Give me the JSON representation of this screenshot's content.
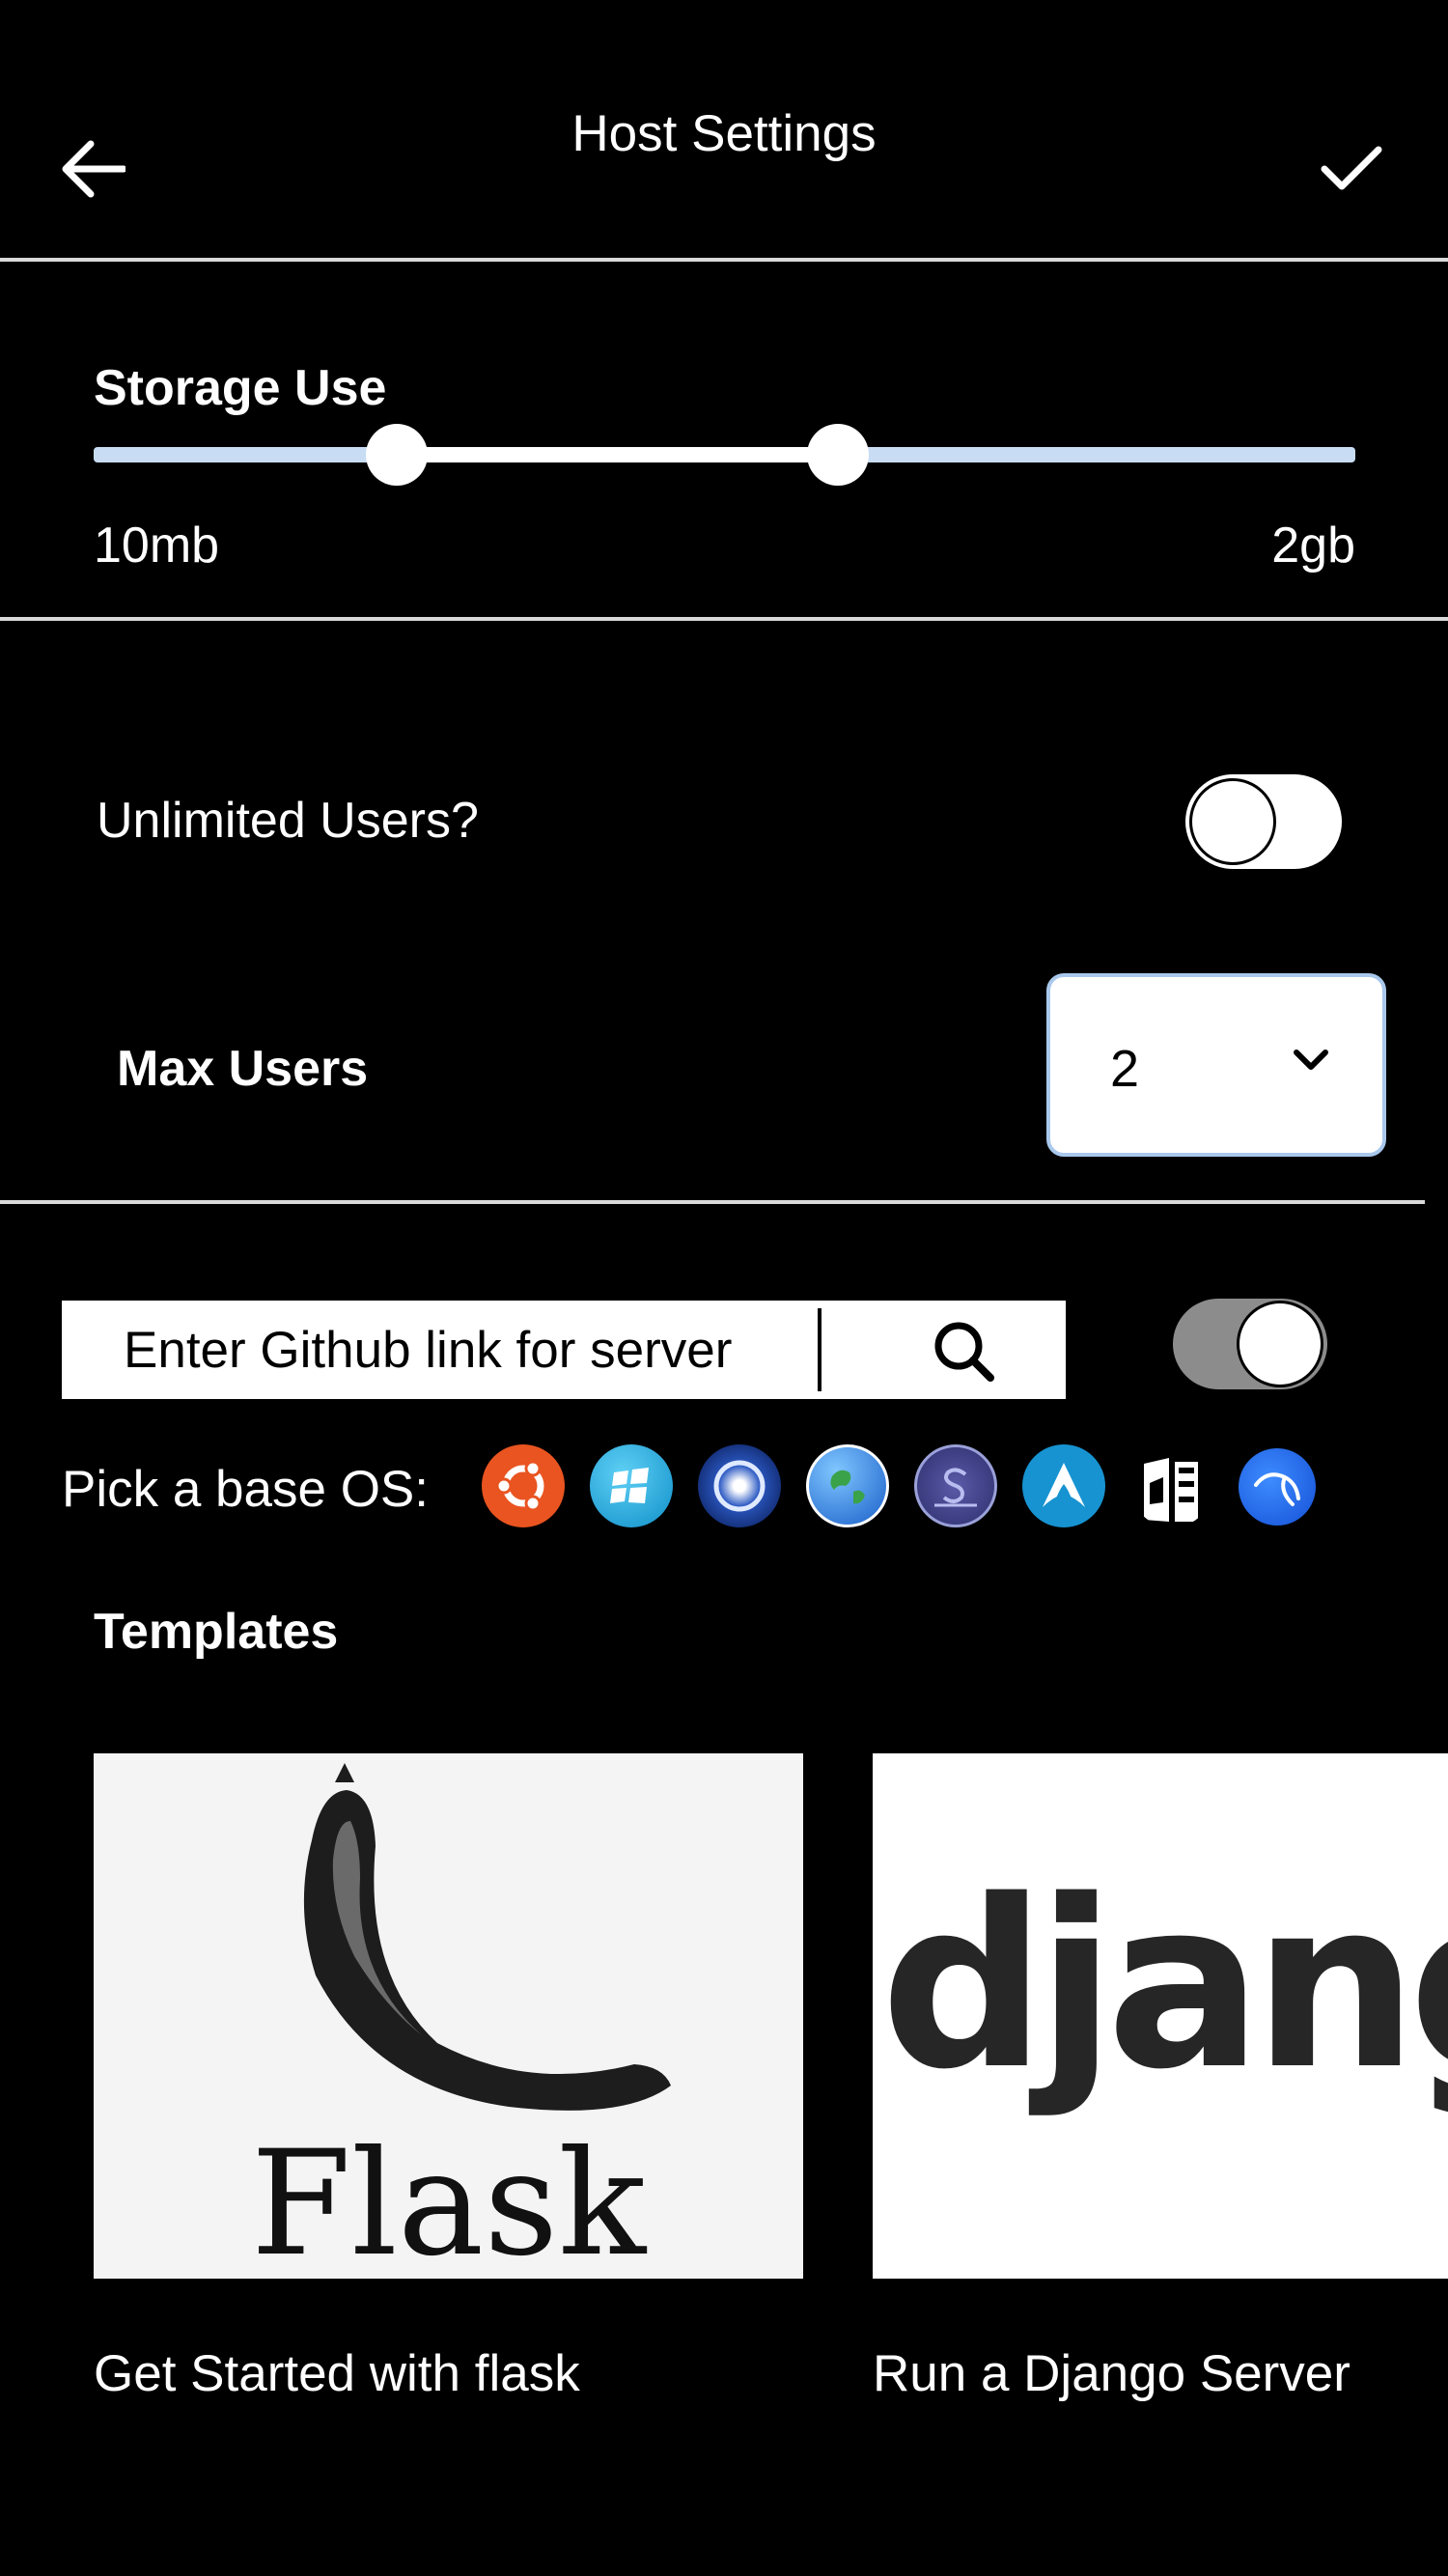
{
  "header": {
    "title": "Host Settings"
  },
  "storage": {
    "label": "Storage Use",
    "min_label": "10mb",
    "max_label": "2gb",
    "range_low_fraction": 0.24,
    "range_high_fraction": 0.59
  },
  "users": {
    "unlimited_label": "Unlimited Users?",
    "unlimited_enabled": false,
    "max_label": "Max Users",
    "max_value": "2"
  },
  "github": {
    "placeholder": "Enter Github link for server",
    "toggle_enabled": true
  },
  "os_picker": {
    "label": "Pick a base OS:",
    "options": [
      "ubuntu-icon",
      "windows-icon",
      "opensuse-icon",
      "globe-icon",
      "solus-icon",
      "arch-icon",
      "elementary-icon",
      "kali-icon"
    ]
  },
  "templates": {
    "heading": "Templates",
    "items": [
      {
        "image_text": "Flask",
        "caption": "Get Started with flask"
      },
      {
        "image_text": "djang",
        "caption": "Run a Django Server"
      }
    ]
  },
  "colors": {
    "background": "#000000",
    "slider_track": "#c8dcf3",
    "select_border": "#a9c8ec",
    "ubuntu": "#e95420",
    "windows": "#1ba1e2",
    "arch": "#1793d1"
  }
}
